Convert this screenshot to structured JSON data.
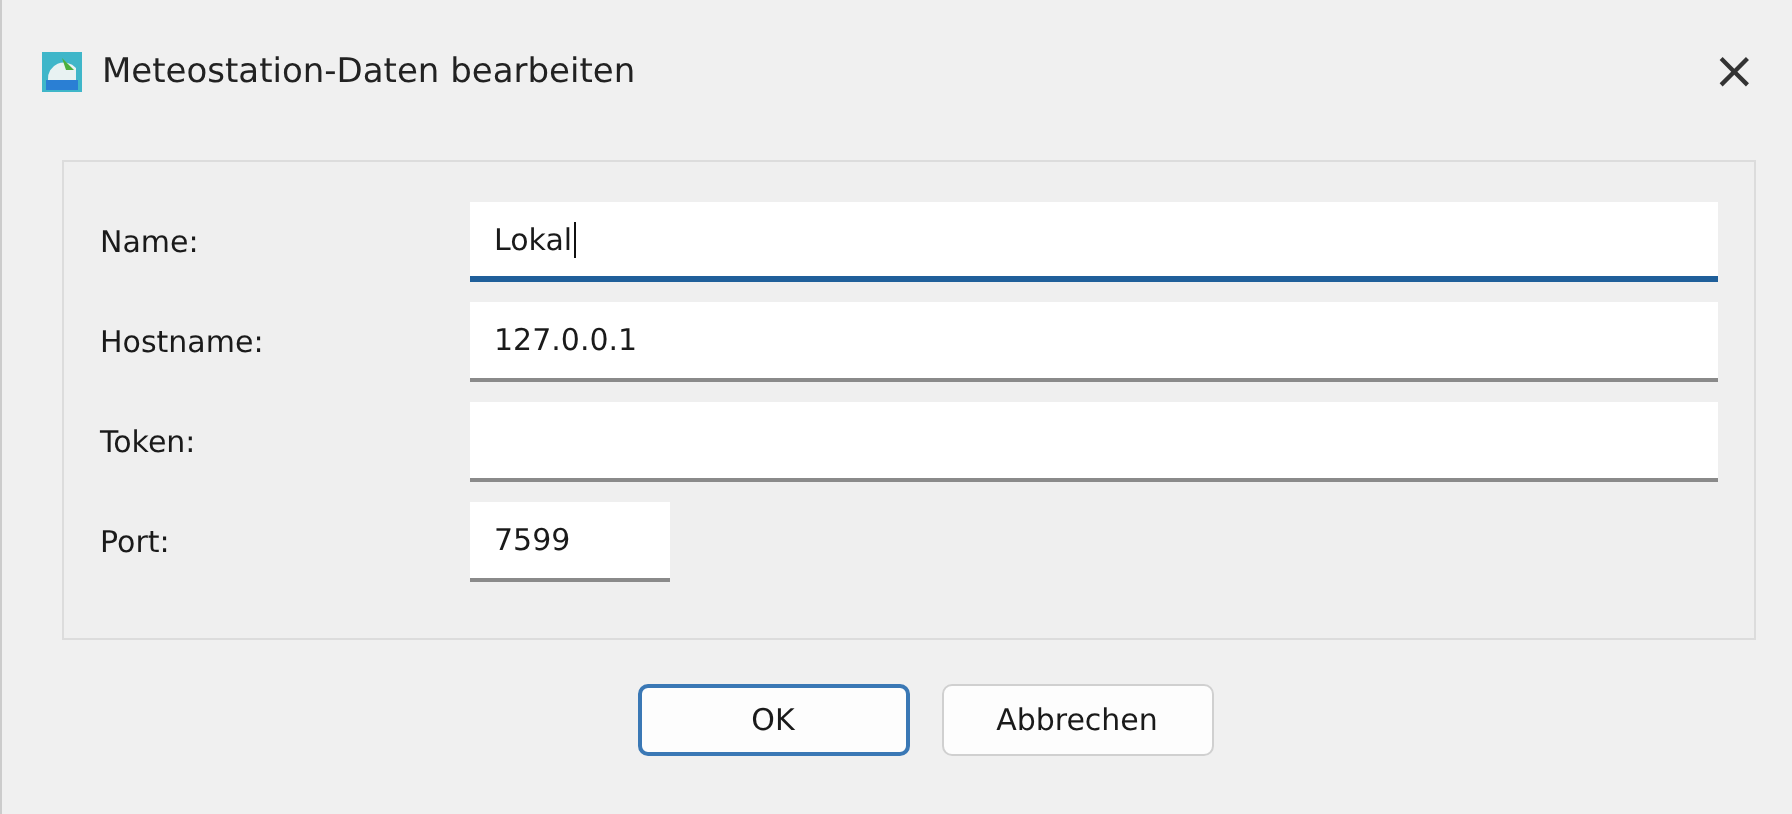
{
  "window": {
    "title": "Meteostation-Daten bearbeiten",
    "close": "×"
  },
  "fields": [
    {
      "label": "Name:",
      "value": "Lokal",
      "kind": "wide",
      "focused": true
    },
    {
      "label": "Hostname:",
      "value": "127.0.0.1",
      "kind": "wide",
      "focused": false
    },
    {
      "label": "Token:",
      "kind": "wide",
      "focused": false
    },
    {
      "label": "Port:",
      "value": "7599",
      "kind": "short",
      "focused": false
    }
  ],
  "buttons": [
    {
      "label": "OK",
      "default": true
    },
    {
      "label": "Abbrechen",
      "default": false
    }
  ]
}
